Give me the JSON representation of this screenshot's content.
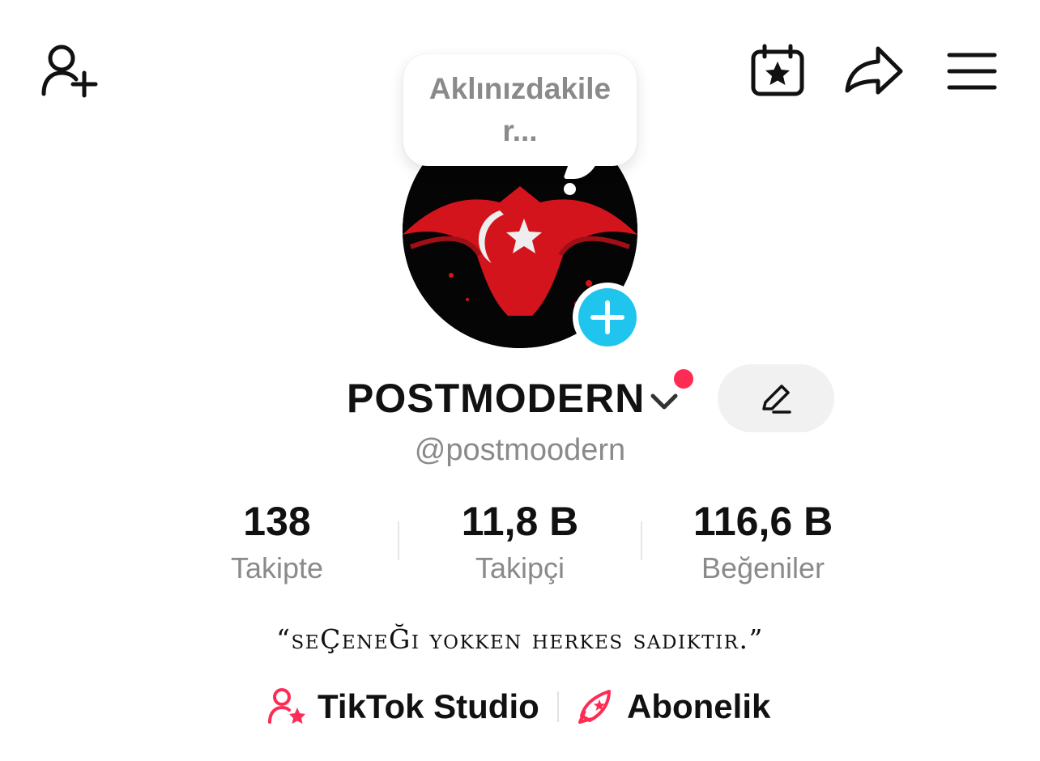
{
  "header": {
    "add_user_icon": "person-plus-icon",
    "calendar_icon": "calendar-star-icon",
    "share_icon": "share-arrow-icon",
    "menu_icon": "hamburger-menu-icon"
  },
  "thought_bubble": {
    "placeholder": "Aklınızdakiler..."
  },
  "profile": {
    "display_name": "POSTMODERN",
    "username": "@postmoodern",
    "bio": "“seÇeneĞi yokken herkes sadıktır.”"
  },
  "stats": [
    {
      "value": "138",
      "label": "Takipte"
    },
    {
      "value": "11,8 B",
      "label": "Takipçi"
    },
    {
      "value": "116,6 B",
      "label": "Beğeniler"
    }
  ],
  "links": {
    "studio": {
      "label": "TikTok Studio",
      "icon": "person-star-icon"
    },
    "subscription": {
      "label": "Abonelik",
      "icon": "rocket-star-icon"
    }
  },
  "colors": {
    "accent_red": "#fe2c55",
    "story_blue": "#20c5ee",
    "muted_text": "#8a8a8a",
    "button_bg": "#f1f1f2"
  }
}
